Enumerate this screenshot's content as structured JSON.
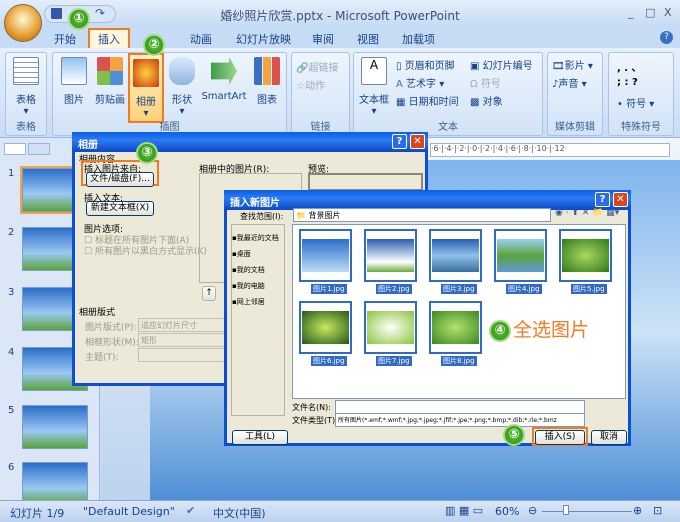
{
  "window": {
    "title": "婚纱照片欣赏.pptx - Microsoft PowerPoint",
    "minimize": "_",
    "maximize": "□",
    "close": "X"
  },
  "tabs": [
    "开始",
    "插入",
    "动画",
    "幻灯片放映",
    "审阅",
    "视图",
    "加载项"
  ],
  "help": "?",
  "ribbon": {
    "table_group": {
      "label": "表格",
      "button": "表格"
    },
    "illustrations_group": {
      "label": "插图",
      "buttons": [
        "图片",
        "剪贴画",
        "相册",
        "形状",
        "SmartArt",
        "图表"
      ]
    },
    "links_group": {
      "label": "链接",
      "buttons": [
        "超链接",
        "动作"
      ]
    },
    "text_group": {
      "label": "文本",
      "textbox": "文本框",
      "items": [
        "页眉和页脚",
        "艺术字",
        "日期和时间",
        "幻灯片编号",
        "符号",
        "对象"
      ]
    },
    "media_group": {
      "label": "媒体剪辑",
      "items": [
        "影片",
        "声音"
      ]
    },
    "special_group": {
      "label": "特殊符号",
      "chars": [
        ", . 、",
        ";  :  ?"
      ],
      "symbol": "符号"
    }
  },
  "slides": [
    "1",
    "2",
    "3",
    "4",
    "5",
    "6"
  ],
  "ruler": "·6·|·4·|·2·|·0·|·2·|·4·|·6·|·8·|·10·|·12·",
  "album_dialog": {
    "title": "相册",
    "section_content": "相册内容",
    "insert_from": "插入图片来自:",
    "file_disk_button": "文件/磁盘(F)...",
    "insert_text": "插入文本:",
    "new_textbox_button": "新建文本框(X)",
    "picture_options": "图片选项:",
    "option_caption": "标题在所有图片下面(A)",
    "option_bw": "所有图片以黑白方式显示(K)",
    "pictures_in_album": "相册中的图片(R):",
    "preview": "预览:",
    "layout_section": "相册版式",
    "picture_layout_label": "图片版式(P):",
    "picture_layout_value": "适应幻灯片尺寸",
    "frame_shape_label": "相框形状(M):",
    "frame_shape_value": "矩形",
    "theme_label": "主题(T):"
  },
  "insert_dialog": {
    "title": "插入新图片",
    "look_in_label": "查找范围(I):",
    "look_in_value": "背景图片",
    "places": [
      "我最近的文档",
      "桌面",
      "我的文档",
      "我的电脑",
      "网上邻居"
    ],
    "files": [
      "图片1.jpg",
      "图片2.jpg",
      "图片3.jpg",
      "图片4.jpg",
      "图片5.jpg",
      "图片6.jpg",
      "图片7.jpg",
      "图片8.jpg"
    ],
    "filename_label": "文件名(N):",
    "filename_value": "",
    "filetype_label": "文件类型(T):",
    "filetype_value": "所有图片(*.emf;*.wmf;*.jpg;*.jpeg;*.jfif;*.jpe;*.png;*.bmp;*.dib;*.rle;*.bmz",
    "tools_button": "工具(L)",
    "insert_button": "插入(S)",
    "cancel_button": "取消"
  },
  "annotations": {
    "steps": [
      "①",
      "②",
      "③",
      "④",
      "⑤"
    ],
    "select_all": "全选图片",
    "accent": "#f47a20"
  },
  "statusbar": {
    "slide": "幻灯片 1/9",
    "theme": "\"Default Design\"",
    "language": "中文(中国)",
    "zoom": "60%"
  }
}
